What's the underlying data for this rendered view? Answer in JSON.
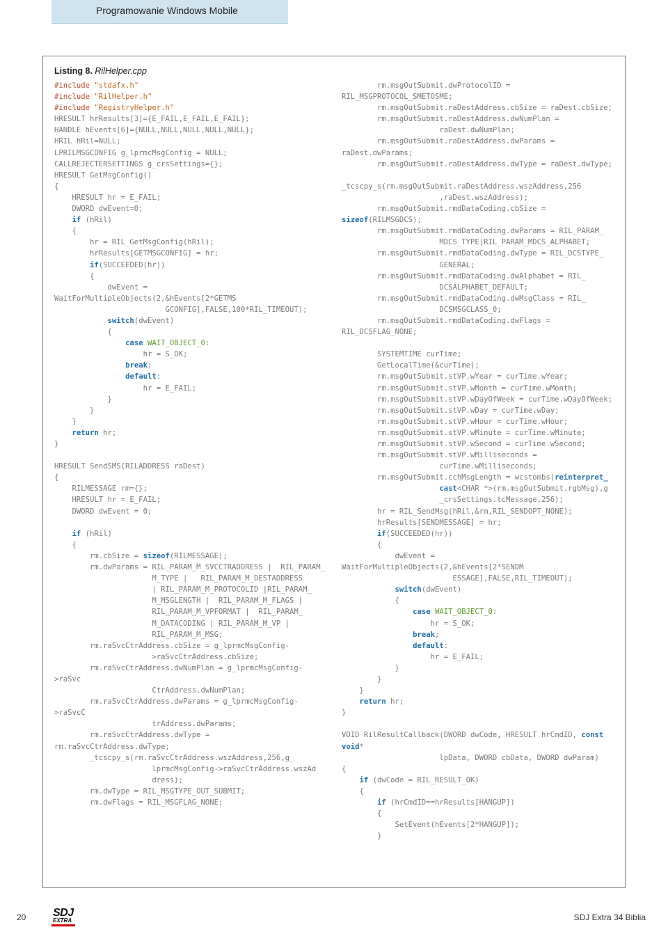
{
  "header": {
    "section": "Programowanie Windows Mobile"
  },
  "listing": {
    "label": "Listing 8.",
    "file": "RilHelper.cpp",
    "col1_html": "<span class=\"op\">#include</span> <span class=\"str\">\"stdafx.h\"</span>\n<span class=\"op\">#include</span> <span class=\"str\">\"RilHelper.h\"</span>\n<span class=\"op\">#include</span> <span class=\"str\">\"RegistryHelper.h\"</span>\nHRESULT hrResults[3]={E_FAIL,E_FAIL,E_FAIL};\nHANDLE hEvents[6]={NULL,NULL,NULL,NULL,NULL};\nHRIL hRil=NULL;\nLPRILMSGCONFIG g_lprmcMsgConfig = NULL;\nCALLREJECTERSETTINGS g_crsSettings={};\nHRESULT GetMsgConfig()\n{\n    HRESULT hr = E_FAIL;\n    DWORD dwEvent=0;\n    <span class=\"kw\">if</span> (hRil)\n    {\n        hr = RIL_GetMsgConfig(hRil);\n        hrResults[GETMSGCONFIG] = hr;\n        <span class=\"kw\">if</span>(SUCCEEDED(hr))\n        {\n            dwEvent = WaitForMultipleObjects(2,&hEvents[2*GETMS\n                         GCONFIG],FALSE,100*RIL_TIMEOUT);\n            <span class=\"kw\">switch</span>(dwEvent)\n            {\n                <span class=\"kw\">case</span> <span class=\"ok\">WAIT_OBJECT_0</span>:\n                    hr = S_OK;\n                <span class=\"kw\">break</span>;\n                <span class=\"kw\">default</span>:\n                    hr = E_FAIL;\n            }\n        }\n    }\n    <span class=\"kw\">return</span> hr;\n}\n\nHRESULT SendSMS(RILADDRESS raDest)\n{\n    RILMESSAGE rm={};\n    HRESULT hr = E_FAIL;\n    DWORD dwEvent = 0;\n\n    <span class=\"kw\">if</span> (hRil)\n    {\n        rm.cbSize = <span class=\"kw\">sizeof</span>(RILMESSAGE);\n        rm.dwParams = RIL_PARAM_M_SVCCTRADDRESS |  RIL_PARAM_\n                      M_TYPE |   RIL_PARAM_M_DESTADDRESS\n                      | RIL_PARAM_M_PROTOCOLID |RIL_PARAM_\n                      M_MSGLENGTH |  RIL_PARAM_M_FLAGS |\n                      RIL_PARAM_M_VPFORMAT |  RIL_PARAM_\n                      M_DATACODING | RIL_PARAM_M_VP |\n                      RIL_PARAM_M_MSG;\n        rm.raSvcCtrAddress.cbSize = g_lprmcMsgConfig-\n                      >raSvcCtrAddress.cbSize;\n        rm.raSvcCtrAddress.dwNumPlan = g_lprmcMsgConfig->raSvc\n                      CtrAddress.dwNumPlan;\n        rm.raSvcCtrAddress.dwParams = g_lprmcMsgConfig->raSvcC\n                      trAddress.dwParams;\n        rm.raSvcCtrAddress.dwType = rm.raSvcCtrAddress.dwType;\n        _tcscpy_s(rm.raSvcCtrAddress.wszAddress,256,g_\n                      lprmcMsgConfig->raSvcCtrAddress.wszAd\n                      dress);\n        rm.dwType = RIL_MSGTYPE_OUT_SUBMIT;\n        rm.dwFlags = RIL_MSGFLAG_NONE;",
    "col2_html": "        rm.msgOutSubmit.dwProtocolID = RIL_MSGPROTOCOL_SMETOSME;\n        rm.msgOutSubmit.raDestAddress.cbSize = raDest.cbSize;\n        rm.msgOutSubmit.raDestAddress.dwNumPlan =\n                      raDest.dwNumPlan;\n        rm.msgOutSubmit.raDestAddress.dwParams = raDest.dwParams;\n        rm.msgOutSubmit.raDestAddress.dwType = raDest.dwType;\n        _tcscpy_s(rm.msgOutSubmit.raDestAddress.wszAddress,256\n                      ,raDest.wszAddress);\n        rm.msgOutSubmit.rmdDataCoding.cbSize = <span class=\"kw\">sizeof</span>(RILMSGDCS);\n        rm.msgOutSubmit.rmdDataCoding.dwParams = RIL_PARAM_\n                      MDCS_TYPE|RIL_PARAM_MDCS_ALPHABET;\n        rm.msgOutSubmit.rmdDataCoding.dwType = RIL_DCSTYPE_\n                      GENERAL;\n        rm.msgOutSubmit.rmdDataCoding.dwAlphabet = RIL_\n                      DCSALPHABET_DEFAULT;\n        rm.msgOutSubmit.rmdDataCoding.dwMsgClass = RIL_\n                      DCSMSGCLASS_0;\n        rm.msgOutSubmit.rmdDataCoding.dwFlags = RIL_DCSFLAG_NONE;\n\n        SYSTEMTIME curTime;\n        GetLocalTime(&curTime);\n        rm.msgOutSubmit.stVP.wYear = curTime.wYear;\n        rm.msgOutSubmit.stVP.wMonth = curTime.wMonth;\n        rm.msgOutSubmit.stVP.wDayOfWeek = curTime.wDayOfWeek;\n        rm.msgOutSubmit.stVP.wDay = curTime.wDay;\n        rm.msgOutSubmit.stVP.wHour = curTime.wHour;\n        rm.msgOutSubmit.stVP.wMinute = curTime.wMinute;\n        rm.msgOutSubmit.stVP.wSecond = curTime.wSecond;\n        rm.msgOutSubmit.stVP.wMilliseconds =\n                      curTime.wMilliseconds;\n        rm.msgOutSubmit.cchMsgLength = wcstombs(<span class=\"kw\">reinterpret_\n                      cast</span>&lt;CHAR *&gt;(rm.msgOutSubmit.rgbMsg),g\n                      _crsSettings.tcMessage,256);\n        hr = RIL_SendMsg(hRil,&rm,RIL_SENDOPT_NONE);\n        hrResults[SENDMESSAGE] = hr;\n        <span class=\"kw\">if</span>(SUCCEEDED(hr))\n        {\n            dwEvent = WaitForMultipleObjects(2,&hEvents[2*SENDM\n                         ESSAGE],FALSE,RIL_TIMEOUT);\n            <span class=\"kw\">switch</span>(dwEvent)\n            {\n                <span class=\"kw\">case</span> <span class=\"ok\">WAIT_OBJECT_0</span>:\n                    hr = S_OK;\n                <span class=\"kw\">break</span>;\n                <span class=\"kw\">default</span>:\n                    hr = E_FAIL;\n            }\n        }\n    }\n    <span class=\"kw\">return</span> hr;\n}\n\nVOID RilResultCallback(DWORD dwCode, HRESULT hrCmdID, <span class=\"kw\">const</span> <span class=\"kw\">void</span>*\n                      lpData, DWORD cbData, DWORD dwParam)\n{\n    <span class=\"kw\">if</span> (dwCode = RIL_RESULT_OK)\n    {\n        <span class=\"kw\">if</span> (hrCmdID==hrResults[HANGUP])\n        {\n            SetEvent(hEvents[2*HANGUP]);\n        }"
  },
  "footer": {
    "page_number": "20",
    "logo_top": "SDJ",
    "logo_bottom": "EXTRA",
    "right_text": "SDJ Extra 34 Biblia"
  }
}
